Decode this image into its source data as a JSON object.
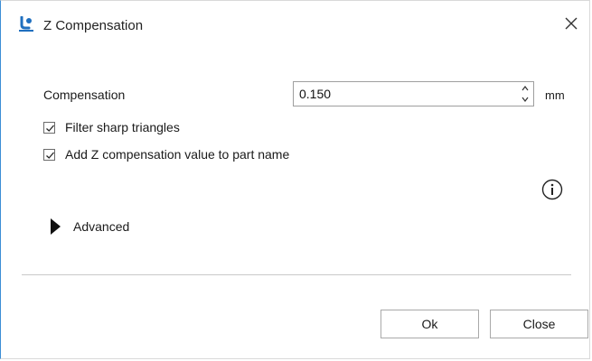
{
  "window": {
    "title": "Z Compensation",
    "app_icon": "materialise-logo-icon",
    "close_icon": "close-icon",
    "accent_color": "#3c8ed6"
  },
  "compensation": {
    "label": "Compensation",
    "value": "0.150",
    "unit": "mm"
  },
  "options": {
    "filter_sharp_triangles": {
      "label": "Filter sharp triangles",
      "checked": true
    },
    "add_z_to_name": {
      "label": "Add Z compensation value to part name",
      "checked": true
    }
  },
  "info_icon": "info-icon",
  "advanced": {
    "label": "Advanced",
    "expanded": false
  },
  "buttons": {
    "ok": "Ok",
    "close": "Close"
  }
}
